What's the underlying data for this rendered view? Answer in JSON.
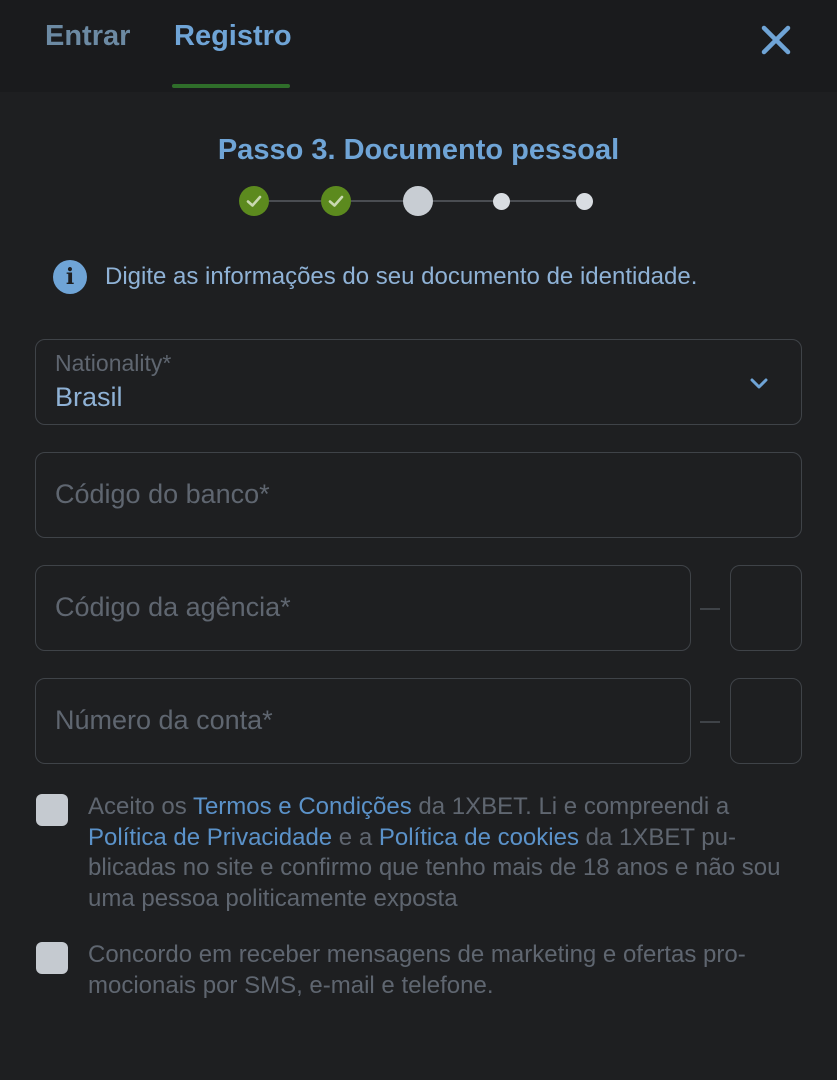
{
  "tabs": {
    "login": "Entrar",
    "register": "Registro",
    "active": "register"
  },
  "icons": {
    "close": "close-icon",
    "check": "check-icon",
    "info": "info-icon",
    "chevron": "chevron-down-icon"
  },
  "colors": {
    "background": "#1e1f21",
    "accent": "#6fa4d6",
    "step_done": "#5c8a1e",
    "link": "#5b92c9"
  },
  "stepper": {
    "title": "Passo 3. Documento pessoal",
    "current_step": 3,
    "total_steps": 5,
    "completed_steps": 2
  },
  "info": {
    "icon_glyph": "i",
    "text": "Digite as informações do seu documento de identidade."
  },
  "form": {
    "nationality": {
      "label": "Nationality*",
      "value": "Brasil"
    },
    "bank_code": {
      "placeholder": "Código do banco*"
    },
    "agency_code": {
      "placeholder": "Código da agência*"
    },
    "account_number": {
      "placeholder": "Número da conta*"
    }
  },
  "consents": {
    "terms": {
      "checked": false,
      "part1": "Aceito os ",
      "link1": "Termos e Condições",
      "part2": " da 1XBET. Li e compreendi a ",
      "link2": "Política de Privacidade",
      "part3": " e a ",
      "link3": "Política de cookies",
      "part4": " da 1XBET pu­blicadas no site e confirmo que tenho mais de 18 anos e não sou uma pessoa politicamente exposta"
    },
    "marketing": {
      "checked": false,
      "text": "Concordo em receber mensagens de marketing e ofertas pro­mocionais por SMS, e-mail e telefone."
    }
  }
}
